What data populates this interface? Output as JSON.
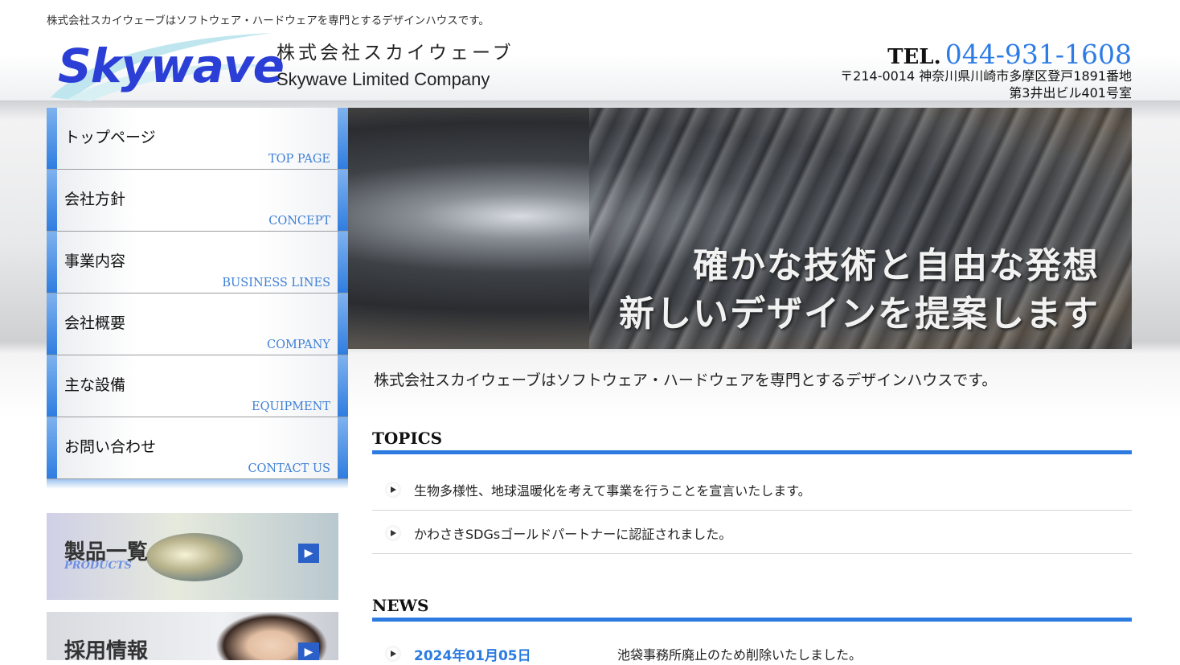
{
  "header": {
    "tagline": "株式会社スカイウェーブはソフトウェア・ハードウェアを専門とするデザインハウスです。",
    "logo_text": "Skywave",
    "company_ja": "株式会社スカイウェーブ",
    "company_en": "Skywave Limited Company",
    "tel_label": "TEL.",
    "tel_number": "044-931-1608",
    "address_line1": "〒214-0014 神奈川県川崎市多摩区登戸1891番地",
    "address_line2": "第3井出ビル401号室"
  },
  "nav": [
    {
      "ja": "トップページ",
      "en": "TOP PAGE"
    },
    {
      "ja": "会社方針",
      "en": "CONCEPT"
    },
    {
      "ja": "事業内容",
      "en": "BUSINESS LINES"
    },
    {
      "ja": "会社概要",
      "en": "COMPANY"
    },
    {
      "ja": "主な設備",
      "en": "EQUIPMENT"
    },
    {
      "ja": "お問い合わせ",
      "en": "CONTACT US"
    }
  ],
  "banners": {
    "products_title": "製品一覧",
    "products_sub": "PRODUCTS",
    "recruit_title": "採用情報"
  },
  "hero": {
    "line1": "確かな技術と自由な発想",
    "line2": "新しいデザインを提案します"
  },
  "main": {
    "intro": "株式会社スカイウェーブはソフトウェア・ハードウェアを専門とするデザインハウスです。",
    "topics_title": "TOPICS",
    "topics": [
      "生物多様性、地球温暖化を考えて事業を行うことを宣言いたします。",
      "かわさきSDGsゴールドパートナーに認証されました。"
    ],
    "news_title": "NEWS",
    "news": [
      {
        "date": "2024年01月05日",
        "text": "池袋事務所廃止のため削除いたしました。"
      }
    ]
  },
  "colors": {
    "accent": "#2b7be0",
    "logo": "#2b3fd6"
  }
}
